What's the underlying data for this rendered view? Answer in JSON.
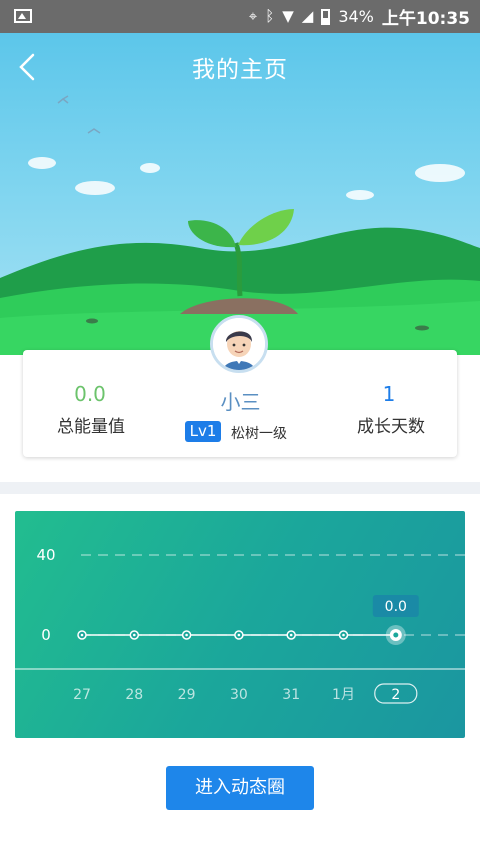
{
  "status_bar": {
    "battery": "34%",
    "time": "上午10:35",
    "icons": [
      "image-icon",
      "location-icon",
      "bluetooth-icon",
      "wifi-icon",
      "signal-icon",
      "battery-icon"
    ]
  },
  "header": {
    "title": "我的主页",
    "back_icon": "chevron-left-icon"
  },
  "profile": {
    "name": "小三",
    "level_badge": "Lv1",
    "rank_name": "松树一级",
    "stats": [
      {
        "value": "0.0",
        "label": "总能量值",
        "color": "#6cc36c"
      },
      {
        "value": "1",
        "label": "成长天数",
        "color": "#1d7de8"
      }
    ]
  },
  "chart_data": {
    "type": "line",
    "categories": [
      "27",
      "28",
      "29",
      "30",
      "31",
      "1月",
      "2"
    ],
    "values": [
      0,
      0,
      0,
      0,
      0,
      0,
      0
    ],
    "selected_index": 6,
    "selected_tooltip": "0.0",
    "y_ticks": [
      "40",
      "0"
    ],
    "ylim": [
      0,
      40
    ],
    "grid": "dashed horizontal",
    "title": "",
    "xlabel": "",
    "ylabel": ""
  },
  "actions": {
    "enter_label": "进入动态圈"
  },
  "colors": {
    "accent": "#1e86ea",
    "energy_green": "#6cc36c",
    "chart_start": "#22bd8f",
    "chart_end": "#1b96a0"
  }
}
